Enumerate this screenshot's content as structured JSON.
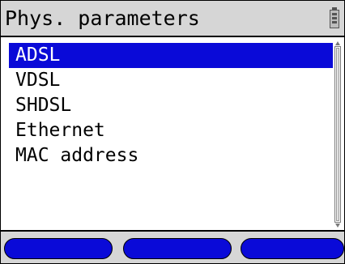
{
  "header": {
    "title": "Phys. parameters",
    "battery_icon": "battery-icon"
  },
  "menu": {
    "items": [
      {
        "label": "ADSL",
        "selected": true
      },
      {
        "label": "VDSL",
        "selected": false
      },
      {
        "label": "SHDSL",
        "selected": false
      },
      {
        "label": "Ethernet",
        "selected": false
      },
      {
        "label": "MAC address",
        "selected": false
      }
    ]
  },
  "softkeys": {
    "left_label": "",
    "middle_label": "",
    "right_label": ""
  },
  "colors": {
    "accent": "#0a0ad8",
    "bar_background": "#d6d6d6",
    "text": "#000000",
    "selected_text": "#ffffff"
  }
}
